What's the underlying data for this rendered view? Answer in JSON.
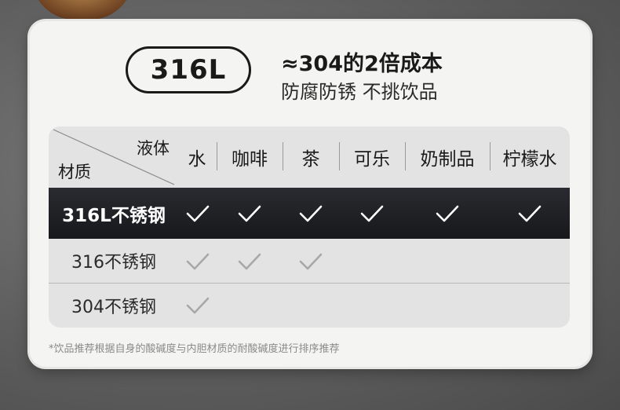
{
  "badge": {
    "text": "316L"
  },
  "headline": {
    "main": "≈304的2倍成本",
    "sub": "防腐防锈 不挑饮品"
  },
  "table": {
    "corner_top": "液体",
    "corner_bottom": "材质",
    "columns": [
      "水",
      "咖啡",
      "茶",
      "可乐",
      "奶制品",
      "柠檬水"
    ],
    "rows": [
      {
        "label": "316L不锈钢",
        "checks": [
          true,
          true,
          true,
          true,
          true,
          true
        ]
      },
      {
        "label": "316不锈钢",
        "checks": [
          true,
          true,
          true,
          false,
          false,
          false
        ]
      },
      {
        "label": "304不锈钢",
        "checks": [
          true,
          false,
          false,
          false,
          false,
          false
        ]
      }
    ]
  },
  "footnote": "*饮品推荐根据自身的酸碱度与内胆材质的耐酸碱度进行排序推荐",
  "colors": {
    "background": "#5e5e5e",
    "card": "#f4f4f2",
    "table": "#e3e3e3",
    "highlight_row": "#1c1d21",
    "check_light": "#ffffff",
    "check_muted": "#a8a8a8"
  },
  "icons": {
    "check": "checkmark-icon"
  }
}
